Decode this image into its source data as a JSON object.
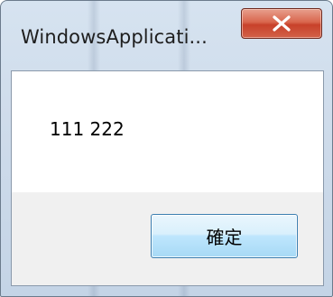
{
  "window": {
    "title": "WindowsApplicati...",
    "close_icon": "close-icon"
  },
  "dialog": {
    "message": "111 222",
    "ok_label": "確定"
  },
  "colors": {
    "frame": "#cfdceb",
    "close_button": "#c8412a",
    "ok_button_border": "#3c7fb1",
    "footer": "#f0f0f0"
  }
}
